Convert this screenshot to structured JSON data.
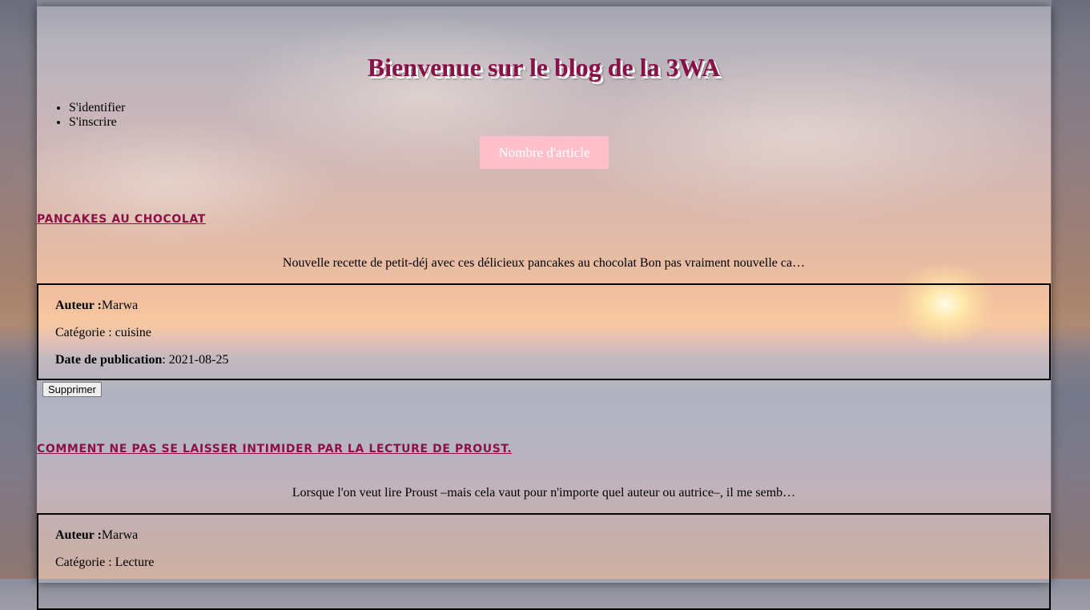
{
  "header": {
    "title": "Bienvenue sur le blog de la 3WA"
  },
  "nav": {
    "items": [
      {
        "label": "S'identifier"
      },
      {
        "label": "S'inscrire"
      }
    ]
  },
  "article_count_button": "Nombre d'article",
  "articles": [
    {
      "title": "PANCAKES AU CHOCOLAT",
      "excerpt": "Nouvelle recette de petit-déj avec ces délicieux pancakes au chocolat Bon pas vraiment nouvelle ca…",
      "author_label": "Auteur :",
      "author": "Marwa",
      "category_text": "Catégorie : cuisine",
      "date_label": "Date de publication",
      "date_value": ": 2021-08-25",
      "delete_label": "Supprimer"
    },
    {
      "title": "COMMENT NE PAS SE LAISSER INTIMIDER PAR LA LECTURE DE PROUST.",
      "excerpt": "Lorsque l'on veut lire Proust –mais cela vaut pour n'importe quel auteur ou autrice–, il me semb…",
      "author_label": "Auteur :",
      "author": "Marwa",
      "category_text": "Catégorie : Lecture"
    }
  ],
  "colors": {
    "title": "#8a1148",
    "button_bg": "#ffc0cb",
    "button_text": "#ffffff"
  }
}
